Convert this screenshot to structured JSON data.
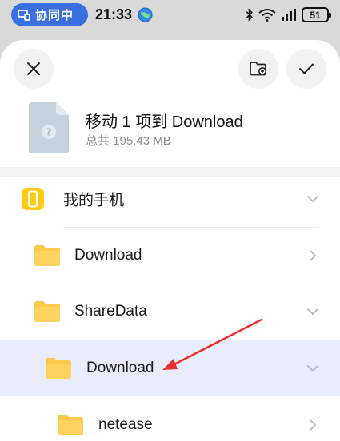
{
  "status_bar": {
    "collab_label": "协同中",
    "time": "21:33",
    "battery": "51"
  },
  "dialog": {
    "title": "移动 1 项到 Download",
    "subtitle": "总共 195.43 MB"
  },
  "tree": {
    "root": "我的手机",
    "items": [
      {
        "label": "Download",
        "expanded": false
      },
      {
        "label": "ShareData",
        "expanded": true
      },
      {
        "label": "Download",
        "expanded": true,
        "selected": true
      },
      {
        "label": "netease",
        "expanded": false
      }
    ]
  },
  "colors": {
    "accent": "#3a6fe0",
    "folder": "#fbc94d",
    "selected_row": "#e8ecfb",
    "arrow": "#e8312f"
  },
  "icons": [
    "collab-icon",
    "globe-icon",
    "bluetooth-icon",
    "wifi-icon",
    "signal-icon",
    "close-icon",
    "new-folder-icon",
    "check-icon",
    "file-unknown-icon",
    "phone-icon",
    "folder-icon",
    "chevron-right-icon",
    "chevron-down-icon"
  ]
}
